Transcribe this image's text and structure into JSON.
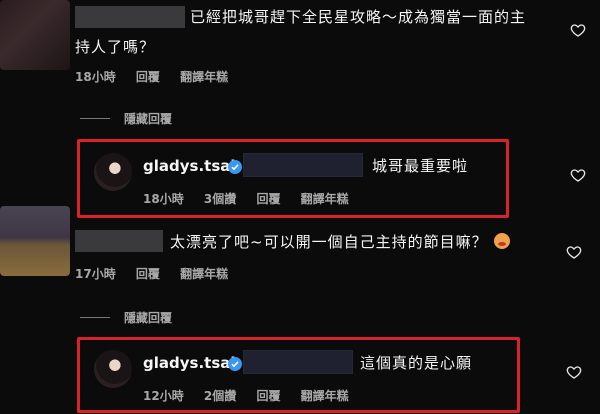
{
  "comments": [
    {
      "text_line1": "已經把城哥趕下全民星攻略～成為獨當一面的主",
      "text_line2": "持人了嗎？",
      "time": "18小時",
      "reply": "回覆",
      "translate": "翻譯年糕"
    },
    {
      "text": "太漂亮了吧~可以開一個自己主持的節目嘛？",
      "time": "17小時",
      "reply": "回覆",
      "translate": "翻譯年糕"
    }
  ],
  "replies": [
    {
      "hidden_label": "隱藏回覆",
      "username": "gladys.tsai",
      "text": "城哥最重要啦",
      "time": "18小時",
      "likes": "3個讚",
      "reply": "回覆",
      "translate": "翻譯年糕"
    },
    {
      "hidden_label": "隱藏回覆",
      "username": "gladys.tsai",
      "text": "這個真的是心願",
      "time": "12小時",
      "likes": "2個讚",
      "reply": "回覆",
      "translate": "翻譯年糕"
    }
  ],
  "colors": {
    "highlight_border": "#d8232a",
    "verified": "#3897f0",
    "background": "#0b0b0c"
  }
}
